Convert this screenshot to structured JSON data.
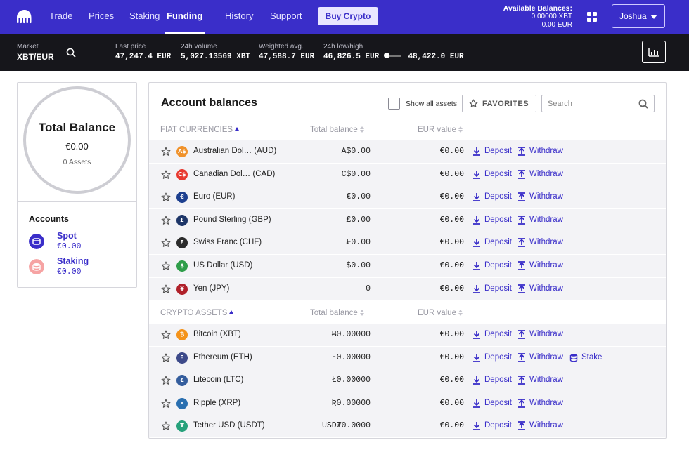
{
  "nav": {
    "items": [
      "Trade",
      "Prices",
      "Staking",
      "Funding",
      "History",
      "Support"
    ],
    "active": "Funding",
    "buy_label": "Buy Crypto",
    "available_title": "Available Balances:",
    "available_xbt": "0.00000 XBT",
    "available_eur": "0.00 EUR",
    "user": "Joshua"
  },
  "market": {
    "market_label": "Market",
    "pair": "XBT/EUR",
    "last_price_label": "Last price",
    "last_price": "47,247.4 EUR",
    "volume_label": "24h volume",
    "volume": "5,027.13569 XBT",
    "wavg_label": "Weighted avg.",
    "wavg": "47,588.7 EUR",
    "lowhigh_label": "24h low/high",
    "low": "46,826.5 EUR",
    "high": "48,422.0 EUR"
  },
  "summary": {
    "title": "Total Balance",
    "amount": "€0.00",
    "assets": "0 Assets",
    "accounts_title": "Accounts",
    "accounts": [
      {
        "name": "Spot",
        "value": "€0.00",
        "color": "#3a2ec9"
      },
      {
        "name": "Staking",
        "value": "€0.00",
        "color": "#f08a8a"
      }
    ]
  },
  "balances": {
    "title": "Account balances",
    "show_all": "Show all assets",
    "favorites": "FAVORITES",
    "search_placeholder": "Search",
    "col_total": "Total balance",
    "col_eur": "EUR value",
    "deposit": "Deposit",
    "withdraw": "Withdraw",
    "stake": "Stake",
    "fiat_title": "FIAT CURRENCIES",
    "crypto_title": "CRYPTO ASSETS",
    "fiat": [
      {
        "symbol": "A$",
        "name": "Australian Dol…",
        "code": "(AUD)",
        "balance": "A$0.00",
        "eur": "€0.00",
        "color": "#f0922b"
      },
      {
        "symbol": "C$",
        "name": "Canadian Dol…",
        "code": "(CAD)",
        "balance": "C$0.00",
        "eur": "€0.00",
        "color": "#e8392f"
      },
      {
        "symbol": "€",
        "name": "Euro",
        "code": "(EUR)",
        "balance": "€0.00",
        "eur": "€0.00",
        "color": "#1d3f8f"
      },
      {
        "symbol": "£",
        "name": "Pound Sterling",
        "code": "(GBP)",
        "balance": "£0.00",
        "eur": "€0.00",
        "color": "#1d3568"
      },
      {
        "symbol": "F",
        "name": "Swiss Franc",
        "code": "(CHF)",
        "balance": "₣0.00",
        "eur": "€0.00",
        "color": "#2b2b2b"
      },
      {
        "symbol": "$",
        "name": "US Dollar",
        "code": "(USD)",
        "balance": "$0.00",
        "eur": "€0.00",
        "color": "#2f9e4a"
      },
      {
        "symbol": "¥",
        "name": "Yen",
        "code": "(JPY)",
        "balance": "0",
        "eur": "€0.00",
        "color": "#b0202a"
      }
    ],
    "crypto": [
      {
        "symbol": "₿",
        "name": "Bitcoin",
        "code": "(XBT)",
        "balance": "Ƀ0.00000",
        "eur": "€0.00",
        "color": "#f4931a",
        "stake": false
      },
      {
        "symbol": "Ξ",
        "name": "Ethereum",
        "code": "(ETH)",
        "balance": "Ξ0.00000",
        "eur": "€0.00",
        "color": "#3d4a8a",
        "stake": true
      },
      {
        "symbol": "Ł",
        "name": "Litecoin",
        "code": "(LTC)",
        "balance": "Ł0.00000",
        "eur": "€0.00",
        "color": "#345d9d",
        "stake": false
      },
      {
        "symbol": "✕",
        "name": "Ripple",
        "code": "(XRP)",
        "balance": "Ʀ0.00000",
        "eur": "€0.00",
        "color": "#2a6fb0",
        "stake": false
      },
      {
        "symbol": "₮",
        "name": "Tether USD",
        "code": "(USDT)",
        "balance": "USD₮0.0000",
        "eur": "€0.00",
        "color": "#26a17b",
        "stake": false
      }
    ]
  },
  "icons": {
    "logo": "kraken-logo-icon",
    "market_search": "search-icon",
    "grid": "grid-icon",
    "chart": "bar-chart-icon",
    "favorite": "star-icon",
    "deposit": "download-icon",
    "withdraw": "upload-icon",
    "stake": "coins-icon"
  }
}
